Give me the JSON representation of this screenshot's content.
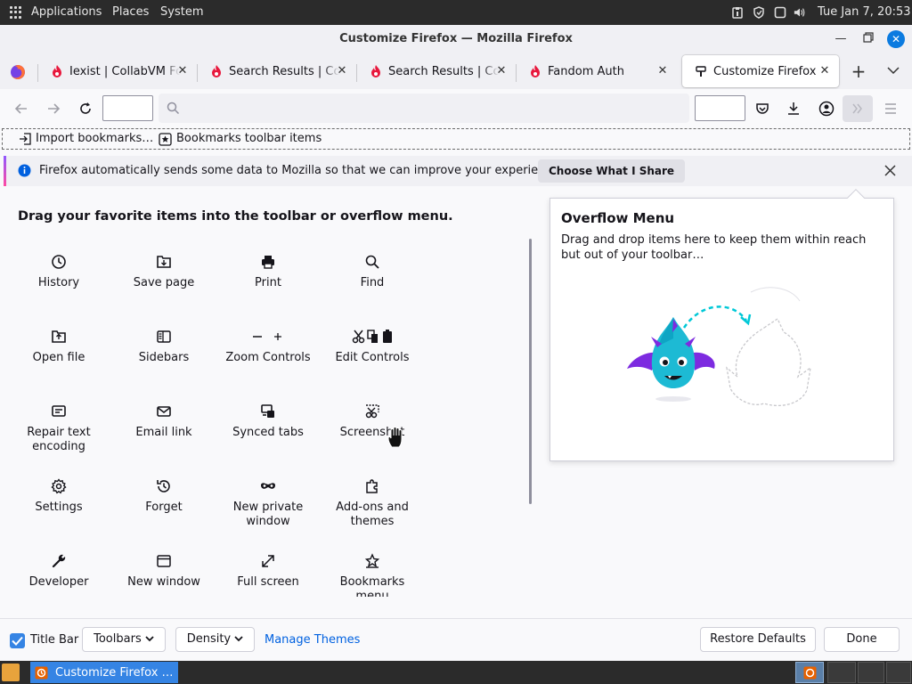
{
  "panel": {
    "applications": "Applications",
    "places": "Places",
    "system": "System",
    "clock": "Tue Jan  7, 20:53"
  },
  "window": {
    "title": "Customize Firefox — Mozilla Firefox"
  },
  "tabs": [
    {
      "label": "Iexist | CollabVM Forum",
      "selected": false
    },
    {
      "label": "Search Results | CollabVM",
      "selected": false
    },
    {
      "label": "Search Results | CollabVM",
      "selected": false
    },
    {
      "label": "Fandom Auth",
      "selected": false
    },
    {
      "label": "Customize Firefox",
      "selected": true
    }
  ],
  "bookmarks": {
    "import": "Import bookmarks…",
    "toolbar_items": "Bookmarks toolbar items"
  },
  "notification": {
    "message": "Firefox automatically sends some data to Mozilla so that we can improve your experience.",
    "button": "Choose What I Share"
  },
  "customize": {
    "heading": "Drag your favorite items into the toolbar or overflow menu.",
    "items": [
      {
        "label": "History",
        "icon": "history-icon"
      },
      {
        "label": "Save page",
        "icon": "save-page-icon"
      },
      {
        "label": "Print",
        "icon": "print-icon"
      },
      {
        "label": "Find",
        "icon": "find-icon"
      },
      {
        "label": "Open file",
        "icon": "open-file-icon"
      },
      {
        "label": "Sidebars",
        "icon": "sidebars-icon"
      },
      {
        "label": "Zoom Controls",
        "icon": "zoom-controls-icon"
      },
      {
        "label": "Edit Controls",
        "icon": "edit-controls-icon"
      },
      {
        "label": "Repair text encoding",
        "icon": "repair-text-encoding-icon"
      },
      {
        "label": "Email link",
        "icon": "email-link-icon"
      },
      {
        "label": "Synced tabs",
        "icon": "synced-tabs-icon"
      },
      {
        "label": "Screenshot",
        "icon": "screenshot-icon"
      },
      {
        "label": "Settings",
        "icon": "settings-icon"
      },
      {
        "label": "Forget",
        "icon": "forget-icon"
      },
      {
        "label": "New private window",
        "icon": "private-window-icon"
      },
      {
        "label": "Add-ons and themes",
        "icon": "addons-icon"
      },
      {
        "label": "Developer",
        "icon": "developer-icon"
      },
      {
        "label": "New window",
        "icon": "new-window-icon"
      },
      {
        "label": "Full screen",
        "icon": "full-screen-icon"
      },
      {
        "label": "Bookmarks menu",
        "icon": "bookmarks-menu-icon"
      }
    ]
  },
  "overflow": {
    "title": "Overflow Menu",
    "description": "Drag and drop items here to keep them within reach but out of your toolbar…"
  },
  "footer": {
    "title_bar": "Title Bar",
    "title_bar_checked": true,
    "toolbars": "Toolbars",
    "density": "Density",
    "manage_themes": "Manage Themes",
    "restore_defaults": "Restore Defaults",
    "done": "Done"
  },
  "taskbar": {
    "window_label": "Customize Firefox …"
  },
  "colors": {
    "accent": "#0061e0",
    "link": "#0061e0",
    "panel_bg": "#2b2b2b",
    "checkbox": "#3584e4"
  }
}
